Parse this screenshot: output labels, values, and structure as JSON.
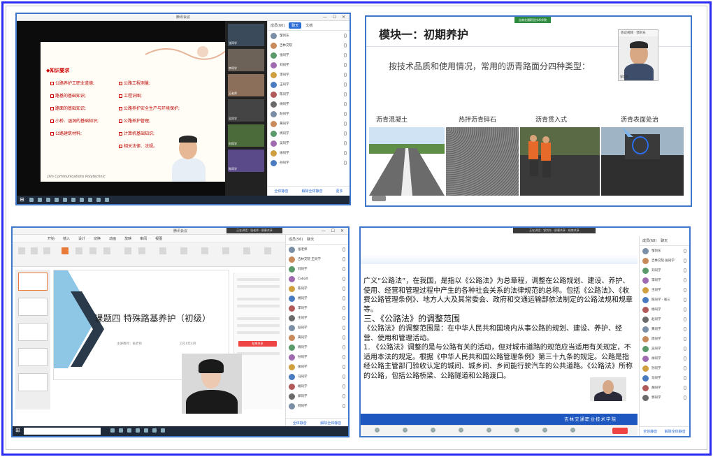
{
  "panel1": {
    "window_title": "腾讯会议",
    "slide_heading": "◆知识要求",
    "left_items": [
      "公路养护工职业道德;",
      "路基的基础知识;",
      "路面的基础知识;",
      "小桥、涵洞的基础知识;",
      "公路建筑材料;"
    ],
    "right_items": [
      "公路工程测量;",
      "工程识图;",
      "公路养护安全生产与环境保护;",
      "公路养护管理;",
      "计算机基础知识;",
      "相关法律、法规。"
    ],
    "slide_footer": "Jilin Communications Polytechnic",
    "sidebar_tabs": [
      "成员(60)",
      "聊天",
      "文档"
    ],
    "sidebar_members": [
      "邹剑东",
      "吉林交院",
      "张同学",
      "刘同学",
      "李同学",
      "王同学",
      "陈同学",
      "杨同学",
      "赵同学",
      "黄同学",
      "周同学",
      "吴同学",
      "徐同学",
      "孙同学"
    ],
    "sidebar_footer": [
      "全体静音",
      "解除全体静音",
      "更多"
    ],
    "video_labels": [
      "张同学",
      "李同学",
      "王老师",
      "吴同学",
      "刘同学",
      "陈同学"
    ]
  },
  "panel2": {
    "title": "模块一：初期养护",
    "subtitle": "按技术品质和使用情况，常用的沥青路面分四种类型：",
    "captions": [
      "沥青混凝土",
      "热拌沥青碎石",
      "沥青贯入式",
      "沥青表面处治"
    ],
    "cam_title": "会议视频 · 邹剑东",
    "cam_name": "邹剑东",
    "top_tab": "吉林交通职业技术学院"
  },
  "panel3": {
    "window_title": "腾讯会议",
    "ribbon_tabs": [
      "开始",
      "插入",
      "设计",
      "切换",
      "动画",
      "放映",
      "审阅",
      "视图"
    ],
    "slide_title": "课题四 特殊路基养护（初级）",
    "slide_small_left": "主讲教师：张老师",
    "slide_small_right": "2020年4月",
    "top_bar": "正在讲话：张老师 · 屏幕共享",
    "red_button": "结束共享",
    "sidebar_tabs": [
      "成员(56)",
      "聊天"
    ],
    "sidebar_members": [
      "张老师",
      "吉林交院 王同学",
      "刘同学",
      "Cobalt",
      "陈同学",
      "杨同学",
      "李同学",
      "王同学",
      "赵同学",
      "黄同学",
      "周同学",
      "孙同学",
      "徐同学",
      "马同学",
      "胡同学",
      "郭同学",
      "何同学"
    ],
    "sidebar_footer": [
      "全体静音",
      "解除全体静音"
    ]
  },
  "panel4": {
    "top_bar": "正在讲话：邹剑东 · 屏幕共享 · 结束共享",
    "paragraph1": "广义“公路法”，在我国，是指以《公路法》为总章程，调整在公路规划、建设、养护、使用、经营和管理过程中产生的各种社会关系的法律规范的总称。包括《公路法》、《收费公路管理条例》、地方人大及其常委会、政府和交通运输部依法制定的公路法规和规章等。",
    "heading": "三、《公路法》的调整范围",
    "paragraph2": "《公路法》的调整范围是：在中华人民共和国境内从事公路的规划、建设、养护、经营、使用和管理活动。",
    "paragraph3": "1. 《公路法》调整的是与公路有关的活动，但对城市道路的规范应当适用有关规定，不适用本法的规定。根据《中华人民共和国公路管理条例》第三十九条的规定。公路是指经公路主管部门验收认定的城间、城乡间、乡间能行驶汽车的公共道路。《公路法》所称的公路，包括公路桥梁、公路隧道和公路渡口。",
    "band_text": "吉林交通职业技术学院",
    "sidebar_tabs": [
      "成员(68)",
      "聊天"
    ],
    "sidebar_members": [
      "邹剑东",
      "吉林交院 张同学",
      "刘同学",
      "李同学",
      "王同学",
      "陈同学 · 张三",
      "杨同学",
      "赵同学",
      "黄同学",
      "周同学",
      "吴同学",
      "徐同学",
      "孙同学",
      "马同学",
      "胡同学",
      "郭同学"
    ],
    "sidebar_footer": [
      "全体静音",
      "解除全体静音"
    ]
  }
}
